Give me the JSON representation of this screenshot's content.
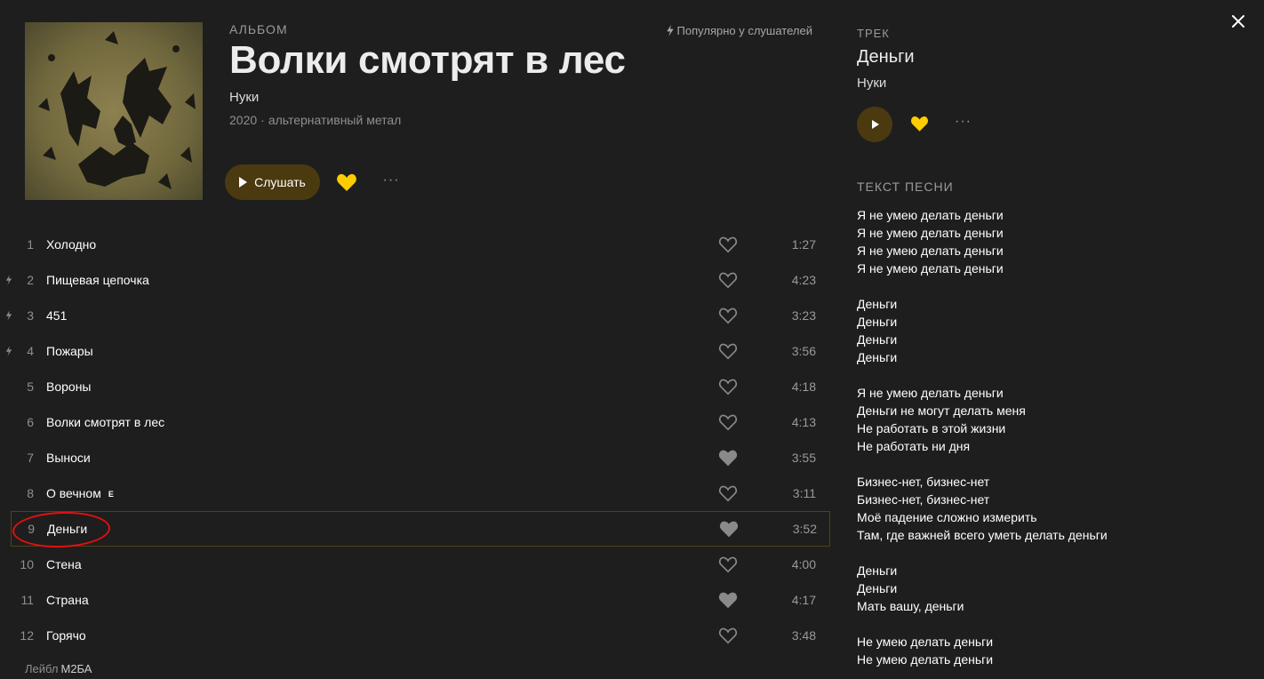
{
  "album": {
    "type": "Альбом",
    "title": "Волки смотрят в лес",
    "artist": "Нуки",
    "year": "2020",
    "genre": "альтернативный метал",
    "popular": "Популярно у слушателей",
    "listen_label": "Слушать",
    "liked": true,
    "label_prefix": "Лейбл",
    "label_name": "M2БА"
  },
  "tracks": [
    {
      "num": "1",
      "title": "Холодно",
      "duration": "1:27",
      "popular": false,
      "liked": false,
      "explicit": false
    },
    {
      "num": "2",
      "title": "Пищевая цепочка",
      "duration": "4:23",
      "popular": true,
      "liked": false,
      "explicit": false
    },
    {
      "num": "3",
      "title": "451",
      "duration": "3:23",
      "popular": true,
      "liked": false,
      "explicit": false
    },
    {
      "num": "4",
      "title": "Пожары",
      "duration": "3:56",
      "popular": true,
      "liked": false,
      "explicit": false
    },
    {
      "num": "5",
      "title": "Вороны",
      "duration": "4:18",
      "popular": false,
      "liked": false,
      "explicit": false
    },
    {
      "num": "6",
      "title": "Волки смотрят в лес",
      "duration": "4:13",
      "popular": false,
      "liked": false,
      "explicit": false
    },
    {
      "num": "7",
      "title": "Выноси",
      "duration": "3:55",
      "popular": false,
      "liked": true,
      "explicit": false
    },
    {
      "num": "8",
      "title": "О вечном",
      "duration": "3:11",
      "popular": false,
      "liked": false,
      "explicit": true,
      "explicit_mark": "E"
    },
    {
      "num": "9",
      "title": "Деньги",
      "duration": "3:52",
      "popular": false,
      "liked": true,
      "explicit": false,
      "active": true
    },
    {
      "num": "10",
      "title": "Стена",
      "duration": "4:00",
      "popular": false,
      "liked": false,
      "explicit": false
    },
    {
      "num": "11",
      "title": "Страна",
      "duration": "4:17",
      "popular": false,
      "liked": true,
      "explicit": false
    },
    {
      "num": "12",
      "title": "Горячо",
      "duration": "3:48",
      "popular": false,
      "liked": false,
      "explicit": false
    }
  ],
  "side": {
    "kicker": "Трек",
    "track_title": "Деньги",
    "track_artist": "Нуки",
    "liked": true,
    "lyrics_heading": "Текст песни",
    "lyrics": [
      [
        "Я не умею делать деньги",
        "Я не умею делать деньги",
        "Я не умею делать деньги",
        "Я не умею делать деньги"
      ],
      [
        "Деньги",
        "Деньги",
        "Деньги",
        "Деньги"
      ],
      [
        "Я не умею делать деньги",
        "Деньги не могут делать меня",
        "Не работать в этой жизни",
        "Не работать ни дня"
      ],
      [
        "Бизнес-нет, бизнес-нет",
        "Бизнес-нет, бизнес-нет",
        "Моё падение сложно измерить",
        "Там, где важней всего уметь делать деньги"
      ],
      [
        "Деньги",
        "Деньги",
        "Мать вашу, деньги"
      ],
      [
        "Не умею делать деньги",
        "Не умею делать деньги"
      ]
    ]
  },
  "colors": {
    "accent": "#ffcc00",
    "button_bg": "#4b3a10",
    "background": "#1e1e1e",
    "annotation": "#e01010"
  },
  "icons": {
    "close": "close-icon",
    "heart": "heart-icon",
    "more": "more-icon",
    "bolt": "lightning-icon",
    "play": "play-icon"
  }
}
